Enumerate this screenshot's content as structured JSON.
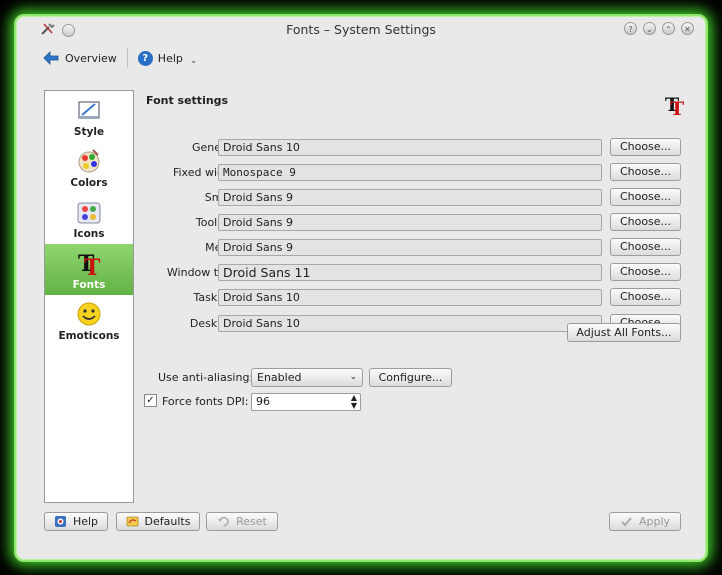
{
  "window": {
    "title": "Fonts – System Settings"
  },
  "toolbar": {
    "overview_label": "Overview",
    "help_label": "Help"
  },
  "sidebar": {
    "items": [
      {
        "label": "Style",
        "icon": "style-icon"
      },
      {
        "label": "Colors",
        "icon": "colors-icon"
      },
      {
        "label": "Icons",
        "icon": "icons-icon"
      },
      {
        "label": "Fonts",
        "icon": "fonts-icon",
        "active": true
      },
      {
        "label": "Emoticons",
        "icon": "emoticons-icon"
      }
    ]
  },
  "main": {
    "section_title": "Font settings",
    "choose_label": "Choose...",
    "font_rows": [
      {
        "label": "General:",
        "value": "Droid Sans 10"
      },
      {
        "label": "Fixed width:",
        "value": "Monospace  9"
      },
      {
        "label": "Small:",
        "value": "Droid Sans 9"
      },
      {
        "label": "Toolbar:",
        "value": "Droid Sans 9"
      },
      {
        "label": "Menu:",
        "value": "Droid Sans 9"
      },
      {
        "label": "Window title:",
        "value": "Droid Sans 11"
      },
      {
        "label": "Taskbar:",
        "value": "Droid Sans 10"
      },
      {
        "label": "Desktop:",
        "value": "Droid Sans 10"
      }
    ],
    "adjust_all_label": "Adjust All Fonts...",
    "antialias": {
      "label": "Use anti-aliasing:",
      "value": "Enabled",
      "configure_label": "Configure..."
    },
    "dpi": {
      "label": "Force fonts DPI:",
      "value": "96",
      "checked": true
    }
  },
  "footer": {
    "help_label": "Help",
    "defaults_label": "Defaults",
    "reset_label": "Reset",
    "apply_label": "Apply"
  },
  "colors": {
    "accent": "#62b344",
    "window_glow": "#3fcf2a"
  }
}
